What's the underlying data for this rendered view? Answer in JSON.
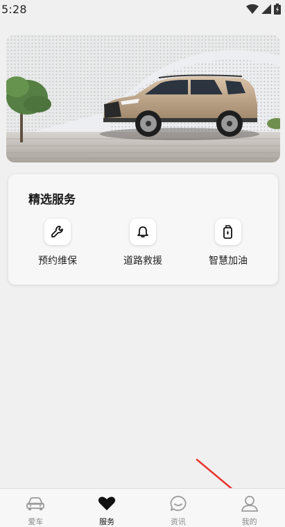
{
  "status_bar": {
    "time": "5:28"
  },
  "banner": {
    "image": "infiniti-suv-banner"
  },
  "services": {
    "title": "精选服务",
    "items": [
      {
        "label": "预约维保",
        "icon": "wrench-icon"
      },
      {
        "label": "道路救援",
        "icon": "bell-icon"
      },
      {
        "label": "智慧加油",
        "icon": "fuel-icon"
      }
    ]
  },
  "bottom_nav": {
    "items": [
      {
        "label": "爱车",
        "icon": "car-icon",
        "active": false
      },
      {
        "label": "服务",
        "icon": "heart-icon",
        "active": true
      },
      {
        "label": "资讯",
        "icon": "chat-icon",
        "active": false
      },
      {
        "label": "我的",
        "icon": "user-icon",
        "active": false
      }
    ]
  },
  "colors": {
    "annotation": "#e8352e",
    "active": "#111111",
    "inactive": "#8a8a8a"
  }
}
